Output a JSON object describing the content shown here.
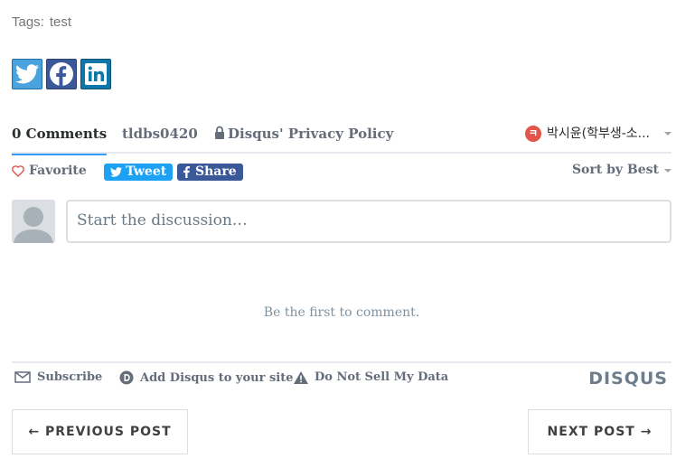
{
  "tags": {
    "label": "Tags:",
    "value": "test"
  },
  "share_icons": [
    "twitter-icon",
    "facebook-icon",
    "linkedin-icon"
  ],
  "disqus": {
    "tabs": {
      "comments": "0 Comments",
      "user": "tldbs0420",
      "privacy": "Disqus' Privacy Policy"
    },
    "account": {
      "badge": "ㅋ",
      "name": "박시윤(학부생-소..."
    },
    "toolbar": {
      "favorite": "Favorite",
      "tweet": "Tweet",
      "share": "Share",
      "sort": "Sort by Best"
    },
    "compose_placeholder": "Start the discussion…",
    "empty_message": "Be the first to comment.",
    "footer": {
      "subscribe": "Subscribe",
      "add_disqus": "Add Disqus to your site",
      "do_not_sell": "Do Not Sell My Data",
      "logo": "DISQUS"
    },
    "colors": {
      "accent": "#2e9fff",
      "twitter": "#1da1f2",
      "facebook": "#3b5998",
      "linkedin": "#0e76a8"
    }
  },
  "post_nav": {
    "previous": "← PREVIOUS POST",
    "next": "NEXT POST →"
  }
}
